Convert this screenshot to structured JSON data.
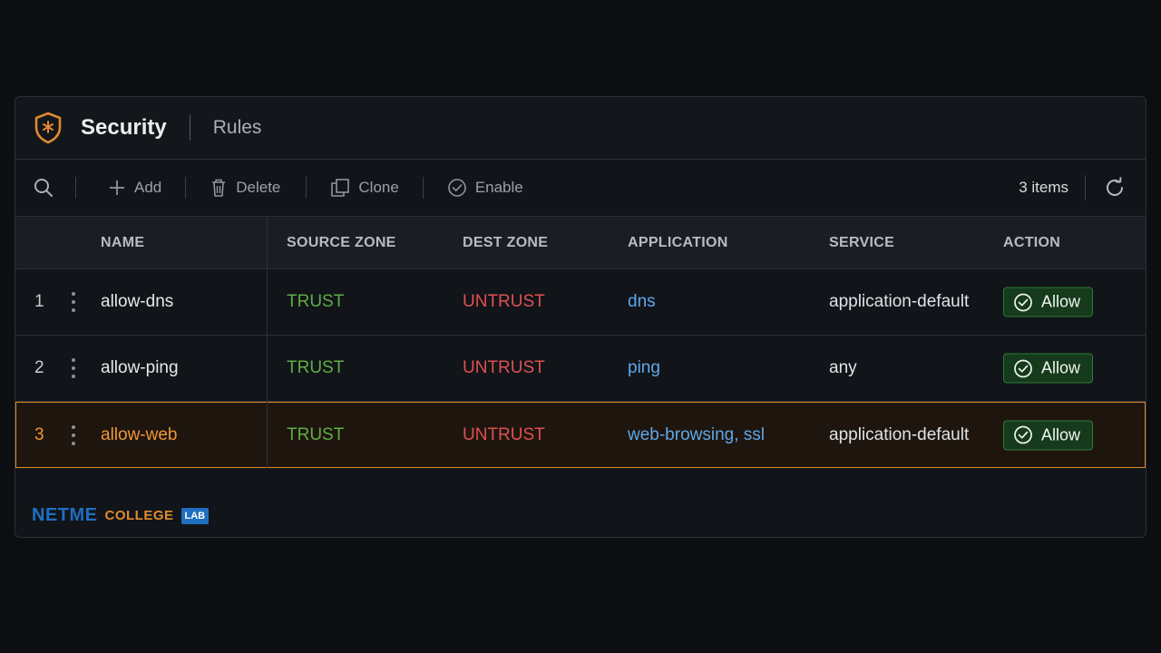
{
  "header": {
    "title": "Security",
    "subtitle": "Rules"
  },
  "toolbar": {
    "search_icon": "search-icon",
    "buttons": [
      {
        "label": "Add",
        "icon": "plus-icon"
      },
      {
        "label": "Delete",
        "icon": "trash-icon"
      },
      {
        "label": "Clone",
        "icon": "clone-icon"
      },
      {
        "label": "Enable",
        "icon": "check-circle-icon"
      }
    ],
    "count": "3 items",
    "refresh_icon": "refresh-icon"
  },
  "table": {
    "columns": [
      "NAME",
      "SOURCE ZONE",
      "DEST ZONE",
      "APPLICATION",
      "SERVICE",
      "ACTION"
    ],
    "rows": [
      {
        "num": "1",
        "name": "allow-dns",
        "source": "TRUST",
        "dest": "UNTRUST",
        "app": "dns",
        "service": "application-default",
        "action": "Allow",
        "selected": false
      },
      {
        "num": "2",
        "name": "allow-ping",
        "source": "TRUST",
        "dest": "UNTRUST",
        "app": "ping",
        "service": "any",
        "action": "Allow",
        "selected": false
      },
      {
        "num": "3",
        "name": "allow-web",
        "source": "TRUST",
        "dest": "UNTRUST",
        "app": "web-browsing, ssl",
        "service": "application-default",
        "action": "Allow",
        "selected": true
      }
    ]
  },
  "footer": {
    "brand_main": "NETME",
    "brand_sub": "COLLEGE",
    "brand_tag": "LAB"
  },
  "colors": {
    "accent": "#e08a2e",
    "trust": "#5fae45",
    "untrust": "#e05050",
    "application": "#5fa7e8",
    "allow_bg": "#163a1c"
  }
}
